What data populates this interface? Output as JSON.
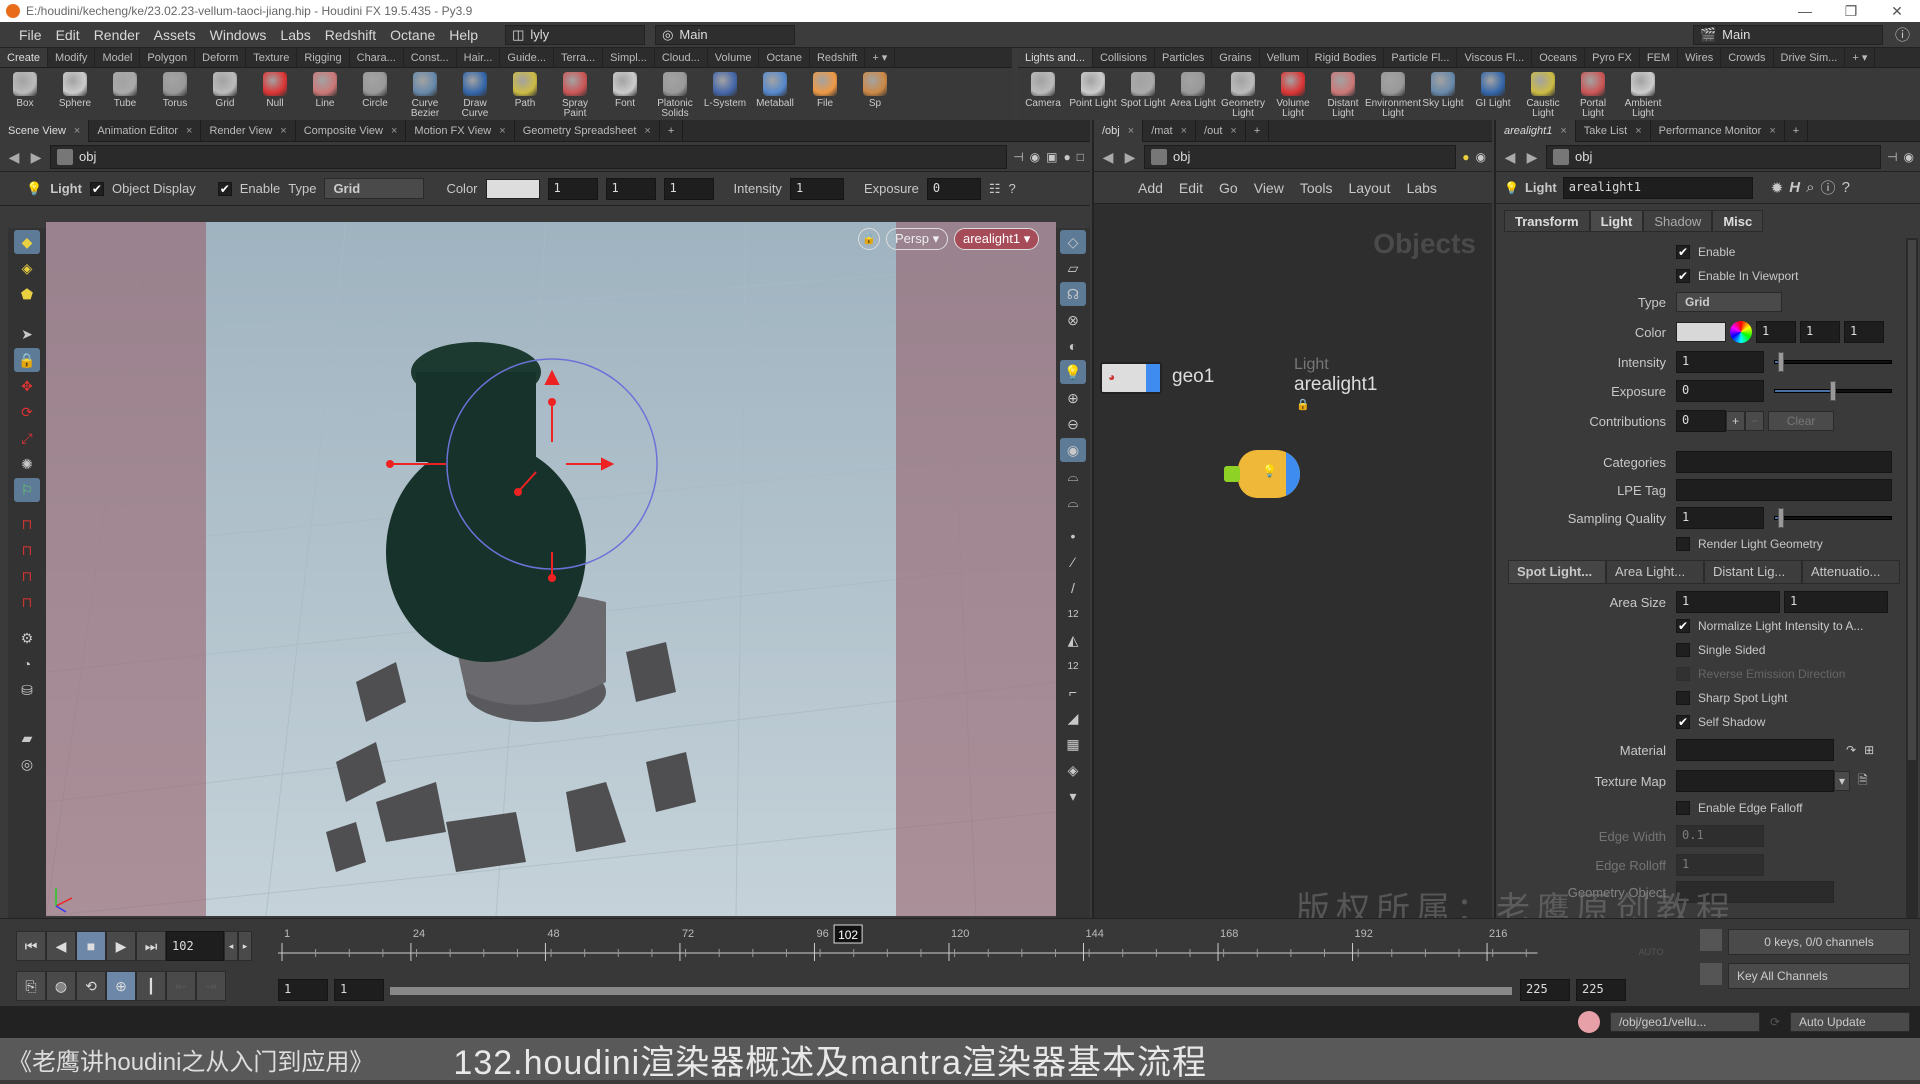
{
  "window": {
    "title": "E:/houdini/kecheng/ke/23.02.23-vellum-taoci-jiang.hip - Houdini FX 19.5.435 - Py3.9",
    "controls": [
      "minimize",
      "maximize",
      "close"
    ]
  },
  "menubar": {
    "items": [
      "File",
      "Edit",
      "Render",
      "Assets",
      "Windows",
      "Labs",
      "Redshift",
      "Octane",
      "Help"
    ],
    "desktop": "lyly",
    "context": "Main",
    "right_desktop": "Main"
  },
  "shelf_left": {
    "tabs": [
      "Create",
      "Modify",
      "Model",
      "Polygon",
      "Deform",
      "Texture",
      "Rigging",
      "Chara...",
      "Const...",
      "Hair...",
      "Guide...",
      "Terra...",
      "Simpl...",
      "Cloud...",
      "Volume",
      "Octane",
      "Redshift"
    ],
    "active_tab": "Create",
    "tools": [
      "Box",
      "Sphere",
      "Tube",
      "Torus",
      "Grid",
      "Null",
      "Line",
      "Circle",
      "Curve Bezier",
      "Draw Curve",
      "Path",
      "Spray Paint",
      "Font",
      "Platonic Solids",
      "L-System",
      "Metaball",
      "File",
      "Sp"
    ]
  },
  "shelf_right": {
    "tabs": [
      "Lights and...",
      "Collisions",
      "Particles",
      "Grains",
      "Vellum",
      "Rigid Bodies",
      "Particle Fl...",
      "Viscous Fl...",
      "Oceans",
      "Pyro FX",
      "FEM",
      "Wires",
      "Crowds",
      "Drive Sim..."
    ],
    "active_tab": "Lights and...",
    "tools": [
      "Camera",
      "Point Light",
      "Spot Light",
      "Area Light",
      "Geometry Light",
      "Volume Light",
      "Distant Light",
      "Environment Light",
      "Sky Light",
      "GI Light",
      "Caustic Light",
      "Portal Light",
      "Ambient Light"
    ]
  },
  "scene_pane": {
    "tabs": [
      "Scene View",
      "Animation Editor",
      "Render View",
      "Composite View",
      "Motion FX View",
      "Geometry Spreadsheet"
    ],
    "active_tab": "Scene View",
    "path": "obj",
    "toolbar": {
      "node_type": "Light",
      "object_display_label": "Object Display",
      "object_display_checked": true,
      "enable_label": "Enable",
      "enable_checked": true,
      "type_label": "Type",
      "type_value": "Grid",
      "color_label": "Color",
      "color_rgb": [
        "1",
        "1",
        "1"
      ],
      "intensity_label": "Intensity",
      "intensity_value": "1",
      "exposure_label": "Exposure",
      "exposure_value": "0"
    },
    "viewport": {
      "camera_menu": "Persp",
      "look_through": "arealight1",
      "axis_color_x": "#ff3030"
    }
  },
  "network_pane": {
    "tabs": [
      "/obj",
      "/mat",
      "/out"
    ],
    "active_tab": "/obj",
    "path": "obj",
    "menu": [
      "Add",
      "Edit",
      "Go",
      "View",
      "Tools",
      "Layout",
      "Labs"
    ],
    "watermark": "Objects",
    "nodes": [
      {
        "name": "geo1",
        "type": ""
      },
      {
        "name": "arealight1",
        "type": "Light"
      }
    ]
  },
  "param_pane": {
    "tabs": [
      "arealight1",
      "Take List",
      "Performance Monitor"
    ],
    "active_tab": "arealight1",
    "path": "obj",
    "node_type": "Light",
    "node_name": "arealight1",
    "folder_tabs": [
      "Transform",
      "Light",
      "Shadow",
      "Misc"
    ],
    "active_folder": "Light",
    "enable": {
      "label": "Enable",
      "checked": true
    },
    "enable_viewport": {
      "label": "Enable In Viewport",
      "checked": true
    },
    "type": {
      "label": "Type",
      "value": "Grid"
    },
    "color": {
      "label": "Color",
      "values": [
        "1",
        "1",
        "1"
      ]
    },
    "intensity": {
      "label": "Intensity",
      "value": "1",
      "slider": 0.05
    },
    "exposure": {
      "label": "Exposure",
      "value": "0",
      "slider": 0.5
    },
    "contributions": {
      "label": "Contributions",
      "value": "0",
      "plus": "+",
      "minus": "−",
      "clear": "Clear"
    },
    "categories": {
      "label": "Categories",
      "value": ""
    },
    "lpe_tag": {
      "label": "LPE Tag",
      "value": ""
    },
    "sampling_quality": {
      "label": "Sampling Quality",
      "value": "1",
      "slider": 0.05
    },
    "render_light_geometry": {
      "label": "Render Light Geometry",
      "checked": false
    },
    "sub_tabs": [
      "Spot Light...",
      "Area Light...",
      "Distant Lig...",
      "Attenuatio..."
    ],
    "active_sub_tab": "Spot Light...",
    "area_size": {
      "label": "Area Size",
      "values": [
        "1",
        "1"
      ]
    },
    "normalize": {
      "label": "Normalize Light Intensity to A...",
      "checked": true
    },
    "single_sided": {
      "label": "Single Sided",
      "checked": false
    },
    "reverse_emission": {
      "label": "Reverse Emission Direction",
      "checked": false,
      "disabled": true
    },
    "sharp_spot": {
      "label": "Sharp Spot Light",
      "checked": false
    },
    "self_shadow": {
      "label": "Self Shadow",
      "checked": true
    },
    "material": {
      "label": "Material",
      "value": ""
    },
    "texture_map": {
      "label": "Texture Map",
      "value": ""
    },
    "edge_falloff": {
      "label": "Enable Edge Falloff",
      "checked": false
    },
    "edge_width": {
      "label": "Edge Width",
      "value": "0.1"
    },
    "edge_rolloff": {
      "label": "Edge Rolloff",
      "value": "1"
    },
    "geometry_object": {
      "label": "Geometry Object",
      "value": ""
    }
  },
  "timeline": {
    "current_frame": "102",
    "ticks": [
      "1",
      "24",
      "48",
      "72",
      "96",
      "120",
      "144",
      "168",
      "192",
      "216"
    ],
    "start_frame": "1",
    "range_start": "1",
    "range_end": "225",
    "end_frame": "225",
    "keys_status": "0 keys, 0/0 channels",
    "key_mode": "Key All Channels",
    "auto_label": "AUTO",
    "frame_range_total": 225
  },
  "statusbar": {
    "path": "/obj/geo1/vellu...",
    "update_mode": "Auto Update"
  },
  "overlay": {
    "course_title": "《老鹰讲houdini之从入门到应用》",
    "lesson_title": "132.houdini渲染器概述及mantra渲染器基本流程",
    "copyright": "版权所属：老鹰原创教程"
  }
}
